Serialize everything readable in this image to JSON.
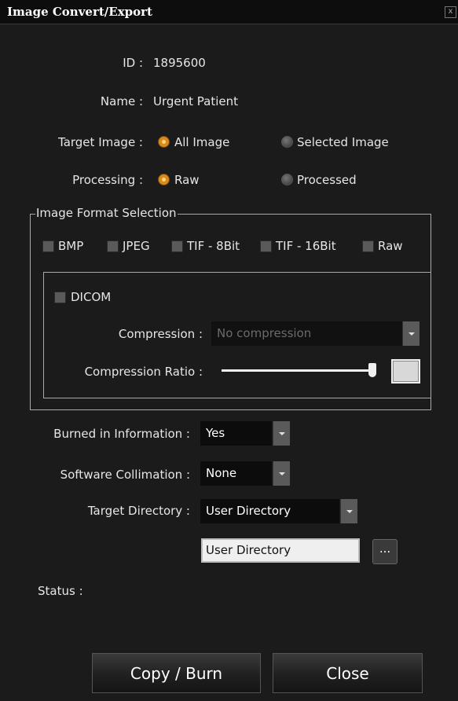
{
  "window": {
    "title": "Image Convert/Export",
    "close_glyph": "x"
  },
  "info": {
    "id_label": "ID :",
    "id_value": "1895600",
    "name_label": "Name :",
    "name_value": "Urgent Patient"
  },
  "target_image": {
    "label": "Target Image :",
    "options": [
      {
        "label": "All Image",
        "selected": true
      },
      {
        "label": "Selected Image",
        "selected": false
      }
    ]
  },
  "processing": {
    "label": "Processing :",
    "options": [
      {
        "label": "Raw",
        "selected": true
      },
      {
        "label": "Processed",
        "selected": false
      }
    ]
  },
  "format": {
    "legend": "Image Format Selection",
    "checkboxes": [
      {
        "label": "BMP",
        "checked": false
      },
      {
        "label": "JPEG",
        "checked": false
      },
      {
        "label": "TIF - 8Bit",
        "checked": false
      },
      {
        "label": "TIF - 16Bit",
        "checked": false
      },
      {
        "label": "Raw",
        "checked": false
      }
    ],
    "dicom": {
      "label": "DICOM",
      "checked": false,
      "compression_label": "Compression :",
      "compression_value": "No compression",
      "ratio_label": "Compression Ratio :",
      "ratio_level": 1.0
    }
  },
  "options": {
    "burned_label": "Burned in Information :",
    "burned_value": "Yes",
    "collimation_label": "Software Collimation :",
    "collimation_value": "None",
    "directory_label": "Target Directory :",
    "directory_value": "User Directory",
    "directory_path": "User Directory",
    "browse_label": "..."
  },
  "status": {
    "label": "Status :"
  },
  "buttons": {
    "copy_burn": "Copy / Burn",
    "close": "Close"
  },
  "colors": {
    "accent_radio": "#d98a1f",
    "background": "#1b1b1b",
    "titlebar": "#0d0d0d"
  }
}
